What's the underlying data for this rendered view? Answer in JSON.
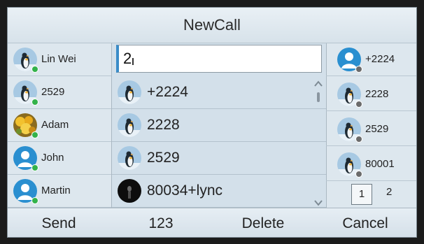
{
  "title": "NewCall",
  "contacts_left": [
    {
      "name": "Lin Wei",
      "avatar": "penguin-photo",
      "status": "online",
      "status_color": "#33b24a"
    },
    {
      "name": "2529",
      "avatar": "penguin-photo",
      "status": "online",
      "status_color": "#33b24a"
    },
    {
      "name": "Adam",
      "avatar": "flower-photo",
      "status": "online",
      "status_color": "#33b24a"
    },
    {
      "name": "John",
      "avatar": "person-silhouette",
      "status": "online",
      "status_color": "#33b24a"
    },
    {
      "name": "Martin",
      "avatar": "person-silhouette",
      "status": "online",
      "status_color": "#33b24a"
    }
  ],
  "search": {
    "value": "2"
  },
  "suggestions": [
    {
      "number": "+2224",
      "avatar": "penguin-photo"
    },
    {
      "number": "2228",
      "avatar": "penguin-photo"
    },
    {
      "number": "2529",
      "avatar": "penguin-photo"
    },
    {
      "number": "80034+lync",
      "avatar": "dark-photo"
    }
  ],
  "recent_right": [
    {
      "number": "+2224",
      "avatar": "person-silhouette",
      "status_color": "#6b6b6b"
    },
    {
      "number": "2228",
      "avatar": "penguin-photo",
      "status_color": "#6b6b6b"
    },
    {
      "number": "2529",
      "avatar": "penguin-photo",
      "status_color": "#6b6b6b"
    },
    {
      "number": "80001",
      "avatar": "penguin-photo",
      "status_color": "#6b6b6b"
    }
  ],
  "pager": {
    "current": "1",
    "other": "2"
  },
  "softkeys": [
    "Send",
    "123",
    "Delete",
    "Cancel"
  ],
  "colors": {
    "accent": "#3a8cc8",
    "silhouette_bg": "#2a8fd0"
  }
}
